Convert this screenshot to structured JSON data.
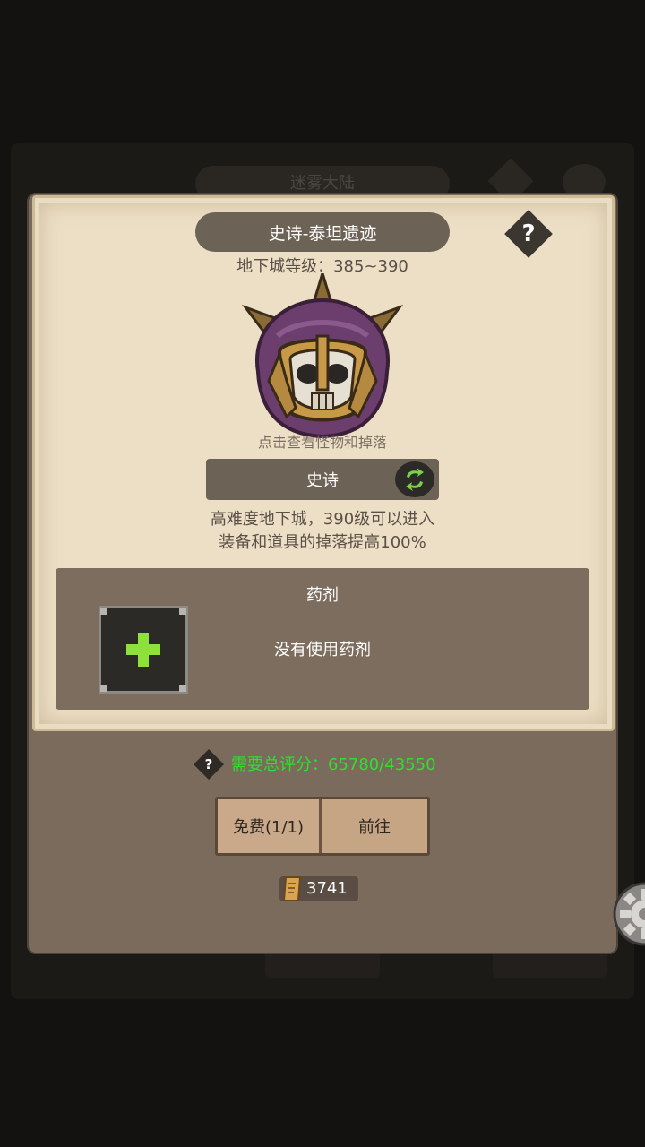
{
  "background": {
    "title": "迷雾大陆"
  },
  "dialog": {
    "dungeon_title": "史诗-泰坦遗迹",
    "help_symbol": "?",
    "level_label": "地下城等级：385~390",
    "monster_hint": "点击查看怪物和掉落",
    "difficulty": "史诗",
    "description_line1": "高难度地下城，390级可以进入",
    "description_line2": "装备和道具的掉落提高100%",
    "potion": {
      "title": "药剂",
      "empty_text": "没有使用药剂"
    },
    "requirement": {
      "help_symbol": "?",
      "text": "需要总评分：65780/43550",
      "color": "#2ee02e"
    },
    "buttons": {
      "free_label": "免费(1/1)",
      "go_label": "前往"
    },
    "currency": {
      "value": "3741",
      "icon": "scroll-ticket-icon"
    }
  },
  "colors": {
    "parchment": "#e8dcc2",
    "panel_brown": "#7a6b5d",
    "plus_green": "#8fe03a"
  }
}
